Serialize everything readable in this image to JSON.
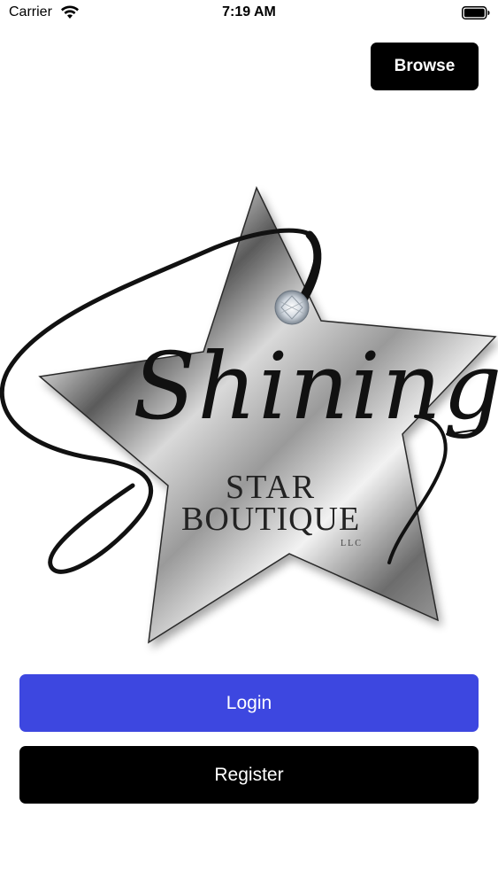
{
  "status_bar": {
    "carrier": "Carrier",
    "time": "7:19 AM",
    "icons": [
      "wifi-icon",
      "battery-icon"
    ]
  },
  "header": {
    "browse_label": "Browse"
  },
  "logo": {
    "word_shining": "Shining",
    "word_star": "STAR",
    "word_boutique": "BOUTIQUE",
    "word_llc": "LLC"
  },
  "actions": {
    "login_label": "Login",
    "register_label": "Register"
  },
  "colors": {
    "login_button": "#3d47e0",
    "register_button": "#000000",
    "browse_button": "#000000"
  }
}
